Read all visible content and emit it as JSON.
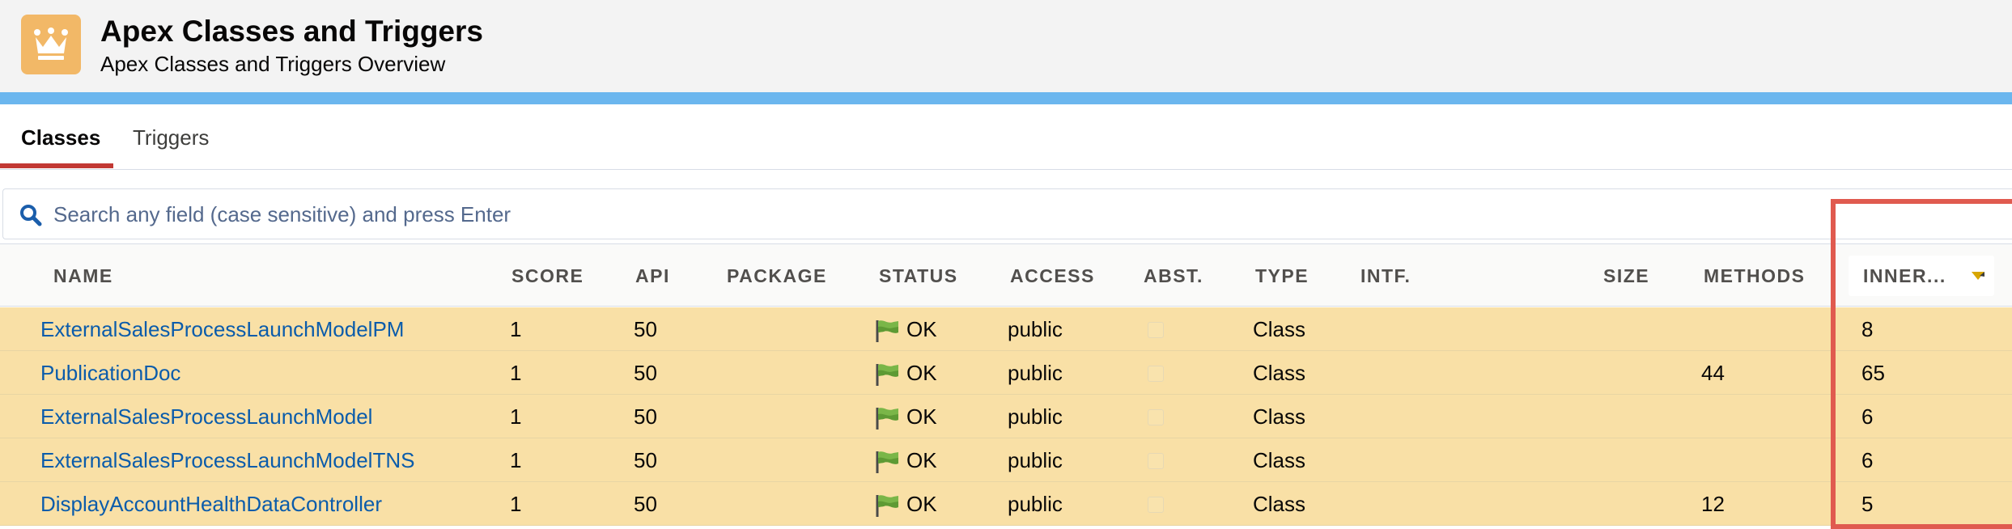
{
  "header": {
    "title": "Apex Classes and Triggers",
    "subtitle": "Apex Classes and Triggers Overview",
    "icon": "crown-icon",
    "icon_bg": "#f2b867"
  },
  "tabs": [
    {
      "label": "Classes",
      "active": true
    },
    {
      "label": "Triggers",
      "active": false
    }
  ],
  "search": {
    "placeholder": "Search any field (case sensitive) and press Enter",
    "value": ""
  },
  "columns": [
    "NAME",
    "SCORE",
    "API",
    "PACKAGE",
    "STATUS",
    "ACCESS",
    "ABST.",
    "TYPE",
    "INTF.",
    "SIZE",
    "METHODS",
    "INNER..."
  ],
  "sorted_column": "INNER...",
  "rows": [
    {
      "name": "ExternalSalesProcessLaunchModelPM",
      "score": "1",
      "api": "50",
      "package": "",
      "status": "OK",
      "access": "public",
      "type": "Class",
      "intf": "",
      "size": "",
      "methods": "",
      "inner": "8"
    },
    {
      "name": "PublicationDoc",
      "score": "1",
      "api": "50",
      "package": "",
      "status": "OK",
      "access": "public",
      "type": "Class",
      "intf": "",
      "size": "",
      "methods": "44",
      "inner": "65"
    },
    {
      "name": "ExternalSalesProcessLaunchModel",
      "score": "1",
      "api": "50",
      "package": "",
      "status": "OK",
      "access": "public",
      "type": "Class",
      "intf": "",
      "size": "",
      "methods": "",
      "inner": "6"
    },
    {
      "name": "ExternalSalesProcessLaunchModelTNS",
      "score": "1",
      "api": "50",
      "package": "",
      "status": "OK",
      "access": "public",
      "type": "Class",
      "intf": "",
      "size": "",
      "methods": "",
      "inner": "6"
    },
    {
      "name": "DisplayAccountHealthDataController",
      "score": "1",
      "api": "50",
      "package": "",
      "status": "OK",
      "access": "public",
      "type": "Class",
      "intf": "",
      "size": "",
      "methods": "12",
      "inner": "5"
    }
  ],
  "colors": {
    "row_highlight": "#f9e0a6",
    "link": "#0b5cab",
    "tab_accent": "#c23934",
    "brand_bar": "#6bb6ee",
    "annotation_box": "#e05a4f"
  }
}
